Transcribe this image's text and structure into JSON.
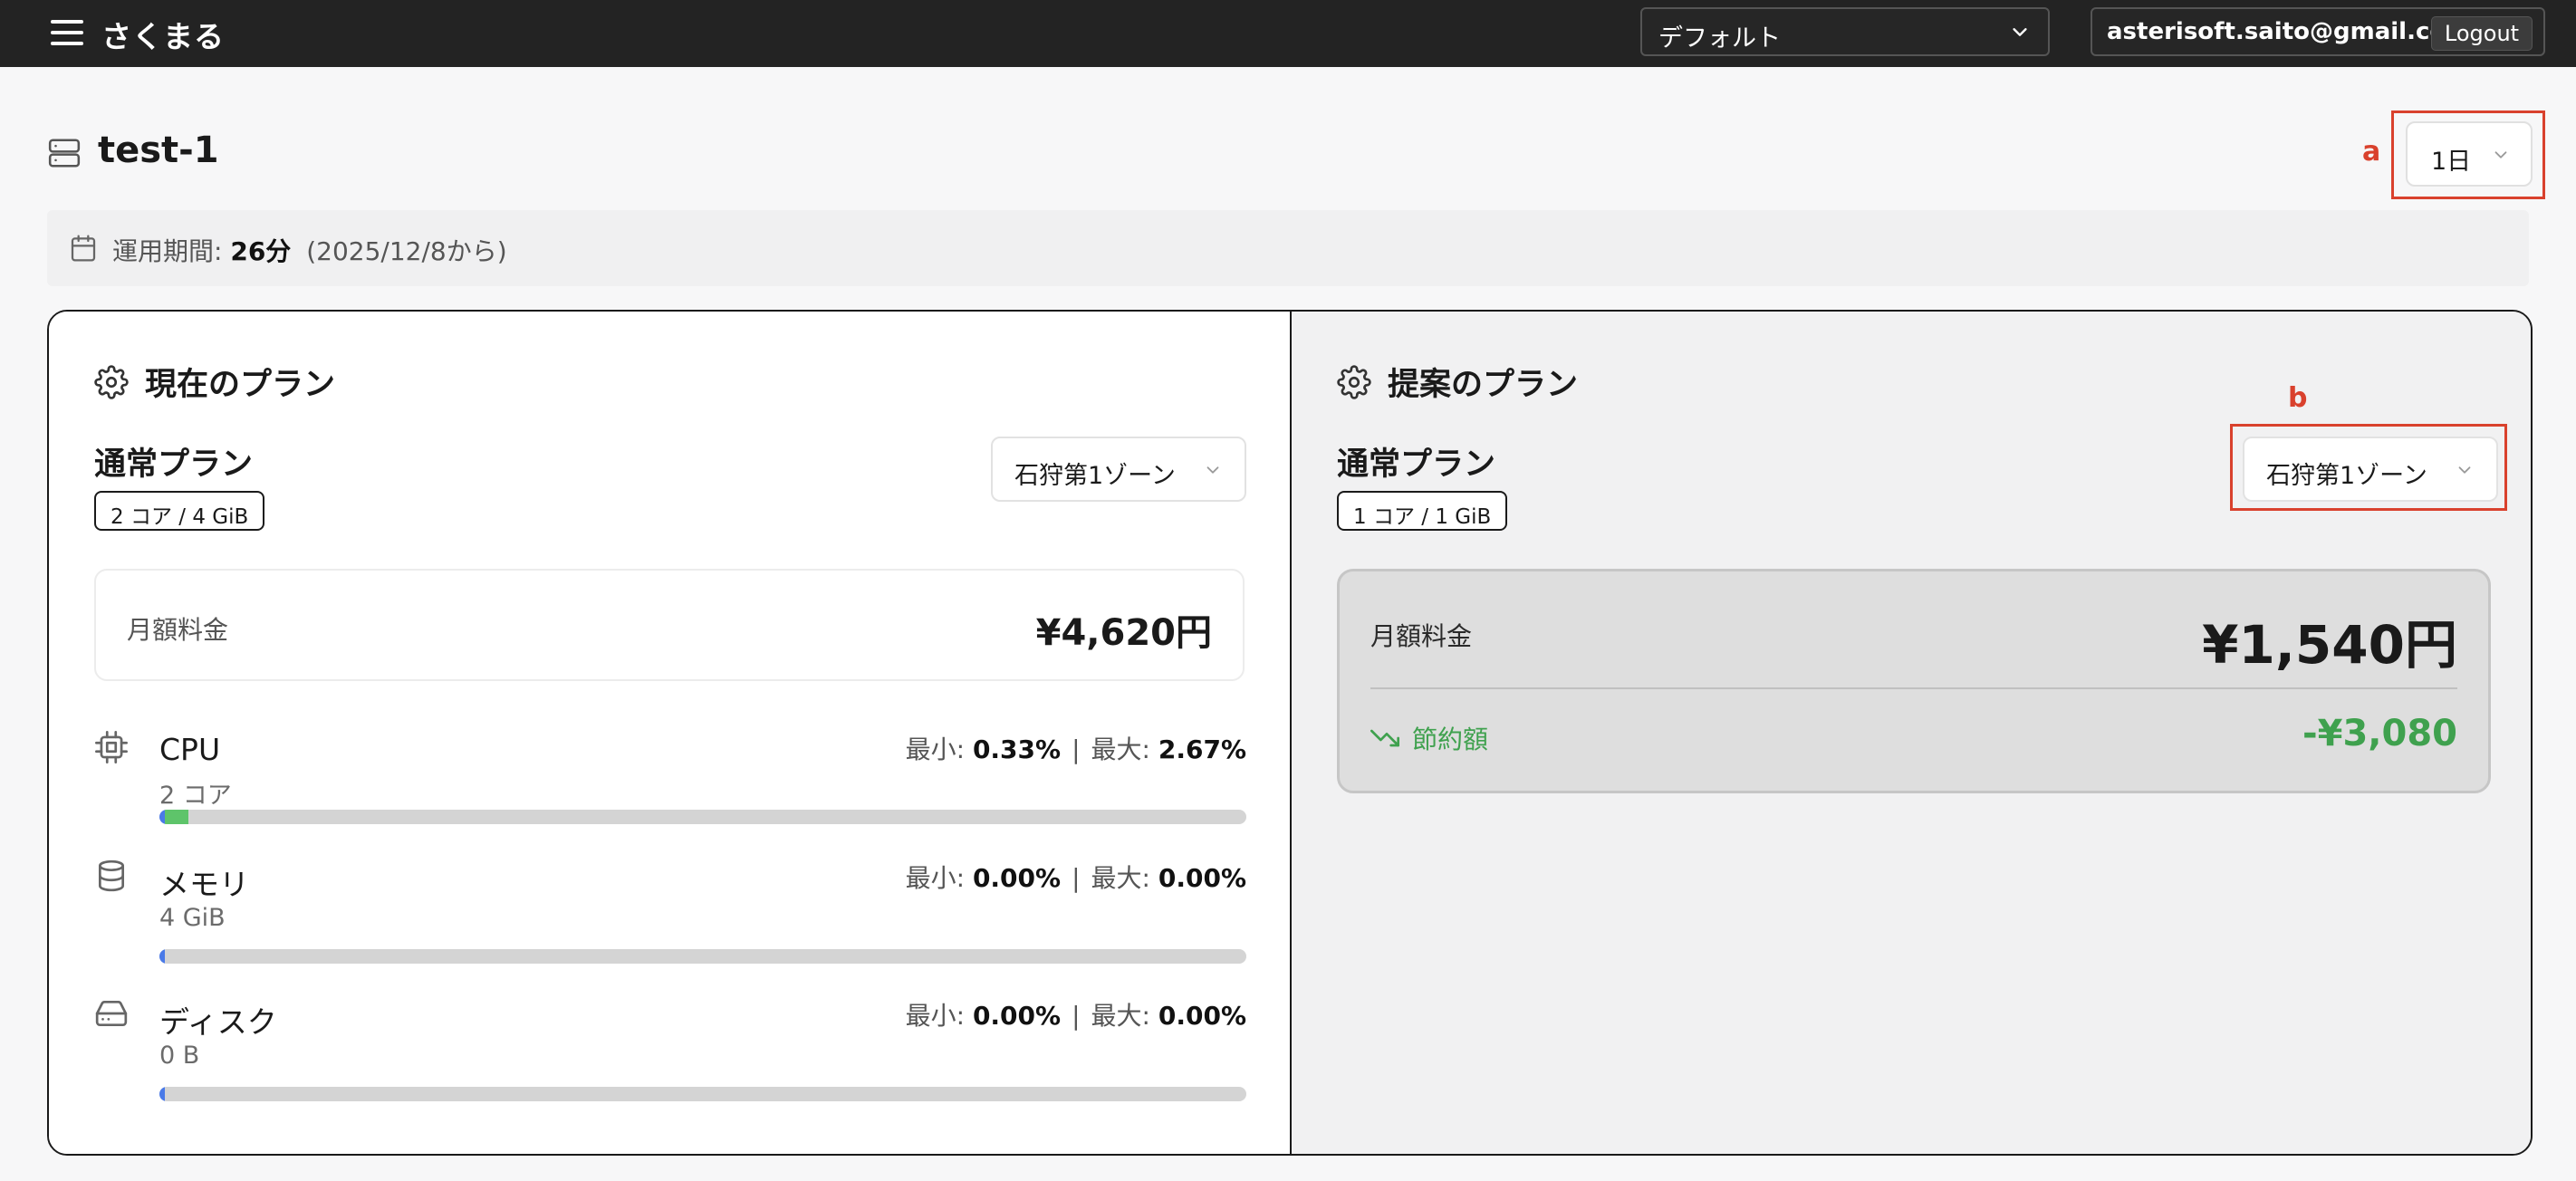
{
  "app": {
    "title": "さくまる"
  },
  "topbar": {
    "environment": "デフォルト",
    "user_email": "asterisoft.saito@gmail.com",
    "logout_label": "Logout"
  },
  "header": {
    "title": "test-1",
    "range_select": "1日"
  },
  "period": {
    "label": "運用期間:",
    "duration": "26分",
    "since": "(2025/12/8から)"
  },
  "annotations": {
    "a": "a",
    "b": "b"
  },
  "current_plan": {
    "heading": "現在のプラン",
    "plan_name": "通常プラン",
    "spec": "2 コア / 4 GiB",
    "zone": "石狩第1ゾーン",
    "fee_label": "月額料金",
    "fee_value": "¥4,620円",
    "metrics": [
      {
        "name": "CPU",
        "sub": "2 コア",
        "min_label": "最小:",
        "min": "0.33%",
        "sep": "|",
        "max_label": "最大:",
        "max": "2.67%",
        "min_ratio": 0.0033,
        "max_ratio": 0.0267
      },
      {
        "name": "メモリ",
        "sub": "4 GiB",
        "min_label": "最小:",
        "min": "0.00%",
        "sep": "|",
        "max_label": "最大:",
        "max": "0.00%",
        "min_ratio": 0.0,
        "max_ratio": 0.0
      },
      {
        "name": "ディスク",
        "sub": "0 B",
        "min_label": "最小:",
        "min": "0.00%",
        "sep": "|",
        "max_label": "最大:",
        "max": "0.00%",
        "min_ratio": 0.0,
        "max_ratio": 0.0
      }
    ]
  },
  "proposed_plan": {
    "heading": "提案のプラン",
    "plan_name": "通常プラン",
    "spec": "1 コア / 1 GiB",
    "zone": "石狩第1ゾーン",
    "fee_label": "月額料金",
    "fee_value": "¥1,540円",
    "savings_label": "節約額",
    "savings_value": "-¥3,080"
  },
  "colors": {
    "topbar_bg": "#232323",
    "annotation": "#d9412d",
    "savings_green": "#3fa14e",
    "bar_min_blue": "#4a7ae8",
    "bar_range_green": "#5ec46a"
  },
  "icons": [
    "menu-icon",
    "chevron-down-icon",
    "server-icon",
    "calendar-icon",
    "gear-icon",
    "cpu-chip-icon",
    "database-icon",
    "hard-drive-icon",
    "trending-down-icon"
  ]
}
